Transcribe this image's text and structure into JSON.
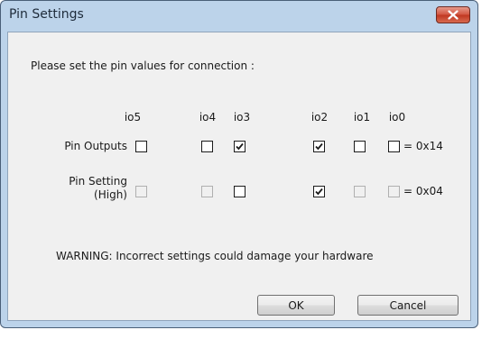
{
  "window": {
    "title": "Pin Settings"
  },
  "dialog": {
    "instruction": "Please set the pin values for connection :",
    "headers": [
      "io5",
      "io4",
      "io3",
      "io2",
      "io1",
      "io0"
    ],
    "pin_outputs": {
      "label": "Pin Outputs",
      "checked": [
        false,
        false,
        true,
        true,
        false,
        false
      ],
      "enabled": [
        true,
        true,
        true,
        true,
        true,
        true
      ],
      "value_text": "= 0x14"
    },
    "pin_setting": {
      "label_line1": "Pin Setting",
      "label_line2": "(High)",
      "checked": [
        false,
        false,
        false,
        true,
        false,
        false
      ],
      "enabled": [
        false,
        false,
        true,
        true,
        false,
        false
      ],
      "value_text": "= 0x04"
    },
    "warning": "WARNING: Incorrect settings could damage your hardware",
    "ok_label": "OK",
    "cancel_label": "Cancel"
  },
  "icons": {
    "close": "close-icon",
    "check": "check-icon"
  }
}
